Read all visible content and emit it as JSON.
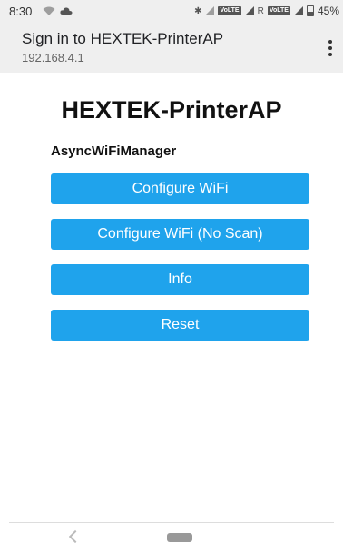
{
  "status_bar": {
    "time": "8:30",
    "battery": "45%",
    "volte_badge": "VoLTE",
    "roaming": "R",
    "icons": [
      "wifi-icon",
      "cloud-icon",
      "bluetooth-icon",
      "signal-icon",
      "battery-icon"
    ]
  },
  "header": {
    "title": "Sign in to HEXTEK-PrinterAP",
    "url": "192.168.4.1",
    "menu_icon": "more-vert-icon"
  },
  "page": {
    "title": "HEXTEK-PrinterAP",
    "subtitle": "AsyncWiFiManager",
    "buttons": [
      {
        "label": "Configure WiFi"
      },
      {
        "label": "Configure WiFi (No Scan)"
      },
      {
        "label": "Info"
      },
      {
        "label": "Reset"
      }
    ],
    "button_color": "#1fa3ec"
  },
  "nav_bar": {
    "icons": [
      "back-icon",
      "home-icon"
    ]
  }
}
